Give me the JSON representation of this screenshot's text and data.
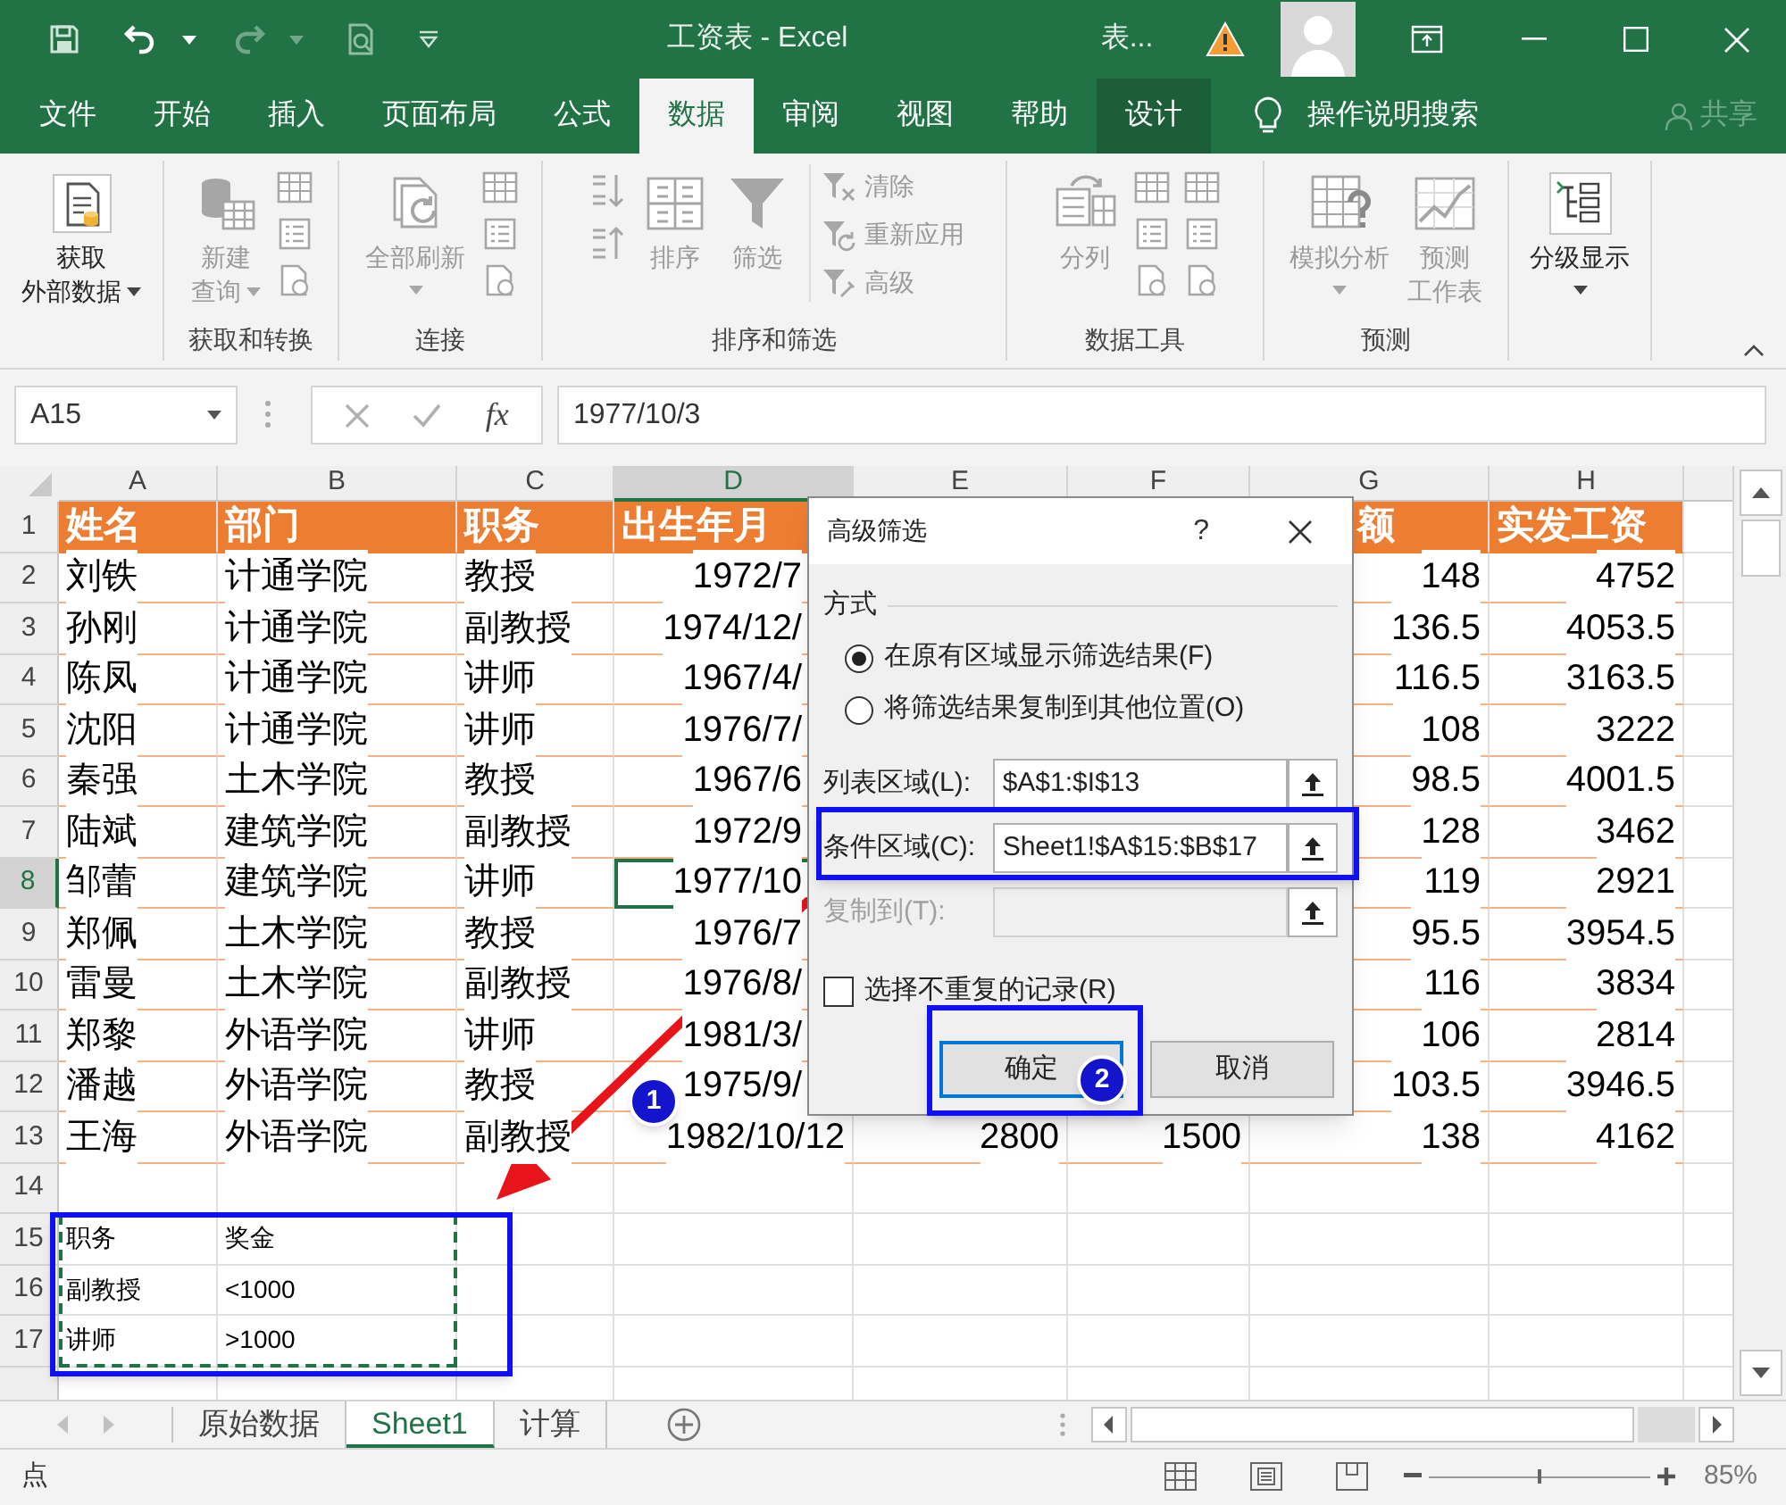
{
  "window": {
    "title": "工资表 - Excel",
    "account": "表...",
    "share": "共享"
  },
  "menu_tabs": [
    {
      "label": "文件",
      "kind": "normal",
      "selected": false
    },
    {
      "label": "开始",
      "kind": "normal",
      "selected": false
    },
    {
      "label": "插入",
      "kind": "normal",
      "selected": false
    },
    {
      "label": "页面布局",
      "kind": "normal",
      "selected": false
    },
    {
      "label": "公式",
      "kind": "normal",
      "selected": false
    },
    {
      "label": "数据",
      "kind": "normal",
      "selected": true
    },
    {
      "label": "审阅",
      "kind": "normal",
      "selected": false
    },
    {
      "label": "视图",
      "kind": "normal",
      "selected": false
    },
    {
      "label": "帮助",
      "kind": "normal",
      "selected": false
    },
    {
      "label": "设计",
      "kind": "contextual",
      "selected": false
    }
  ],
  "tell_me": "操作说明搜索",
  "ribbon_groups": [
    {
      "items": [
        {
          "kind": "large",
          "lines": [
            "获取",
            "外部数据"
          ],
          "dropdown": true,
          "disabled": false
        }
      ]
    },
    {
      "label": "获取和转换",
      "items": [
        {
          "kind": "large",
          "lines": [
            "新建",
            "查询"
          ],
          "dropdown": true,
          "disabled": true
        },
        {
          "kind": "tool_column",
          "disabled": true
        }
      ]
    },
    {
      "label": "连接",
      "items": [
        {
          "kind": "large",
          "lines": [
            "全部刷新"
          ],
          "dropdown": true,
          "disabled": true
        },
        {
          "kind": "tool_column",
          "disabled": true
        }
      ]
    },
    {
      "label": "排序和筛选",
      "items": [
        {
          "kind": "sort_column",
          "disabled": true
        },
        {
          "kind": "large",
          "lines": [
            "排序"
          ],
          "dropdown": false,
          "disabled": true
        },
        {
          "kind": "large",
          "lines": [
            "筛选"
          ],
          "dropdown": false,
          "disabled": true
        },
        {
          "kind": "text_stack",
          "entries": [
            {
              "label": "清除",
              "disabled": true
            },
            {
              "label": "重新应用",
              "disabled": true
            },
            {
              "label": "高级",
              "disabled": true
            }
          ]
        }
      ]
    },
    {
      "label": "数据工具",
      "items": [
        {
          "kind": "large",
          "lines": [
            "分列"
          ],
          "dropdown": false,
          "disabled": true
        },
        {
          "kind": "tool_column",
          "disabled": true
        },
        {
          "kind": "tool_column",
          "disabled": true
        }
      ]
    },
    {
      "label": "预测",
      "items": [
        {
          "kind": "large",
          "lines": [
            "模拟分析"
          ],
          "dropdown": true,
          "disabled": true
        },
        {
          "kind": "large",
          "lines": [
            "预测",
            "工作表"
          ],
          "dropdown": false,
          "disabled": true
        }
      ]
    },
    {
      "items": [
        {
          "kind": "large",
          "lines": [
            "分级显示"
          ],
          "dropdown": true,
          "disabled": false
        }
      ]
    }
  ],
  "formula_bar": {
    "name_box": "A15",
    "function_button": "fx",
    "value": "1977/10/3"
  },
  "sheet": {
    "copy_marquee": true,
    "columns": [
      {
        "letter": "A",
        "selected": false
      },
      {
        "letter": "B",
        "selected": false
      },
      {
        "letter": "C",
        "selected": false
      },
      {
        "letter": "D",
        "selected": true
      },
      {
        "letter": "E",
        "selected": false
      },
      {
        "letter": "F",
        "selected": false
      },
      {
        "letter": "G",
        "selected": false
      },
      {
        "letter": "H",
        "selected": false
      }
    ],
    "rows": [
      {
        "number": "1",
        "kind": "header",
        "selected": false,
        "cells": {
          "A": "姓名",
          "B": "部门",
          "C": "职务",
          "D": "出生年月",
          "G": "额",
          "H": "实发工资"
        }
      },
      {
        "number": "2",
        "kind": "record",
        "selected": false,
        "cells": {
          "A": "刘铁",
          "B": "计通学院",
          "C": "教授",
          "D": "1972/7",
          "G": "148",
          "H": "4752"
        }
      },
      {
        "number": "3",
        "kind": "record",
        "selected": false,
        "cells": {
          "A": "孙刚",
          "B": "计通学院",
          "C": "副教授",
          "D": "1974/12/",
          "G": "136.5",
          "H": "4053.5"
        }
      },
      {
        "number": "4",
        "kind": "record",
        "selected": false,
        "cells": {
          "A": "陈凤",
          "B": "计通学院",
          "C": "讲师",
          "D": "1967/4/",
          "G": "116.5",
          "H": "3163.5"
        }
      },
      {
        "number": "5",
        "kind": "record",
        "selected": false,
        "cells": {
          "A": "沈阳",
          "B": "计通学院",
          "C": "讲师",
          "D": "1976/7/",
          "G": "108",
          "H": "3222"
        }
      },
      {
        "number": "6",
        "kind": "record",
        "selected": false,
        "cells": {
          "A": "秦强",
          "B": "土木学院",
          "C": "教授",
          "D": "1967/6",
          "G": "98.5",
          "H": "4001.5"
        }
      },
      {
        "number": "7",
        "kind": "record",
        "selected": false,
        "cells": {
          "A": "陆斌",
          "B": "建筑学院",
          "C": "副教授",
          "D": "1972/9",
          "G": "128",
          "H": "3462"
        }
      },
      {
        "number": "8",
        "kind": "record",
        "selected": true,
        "cells": {
          "A": "邹蕾",
          "B": "建筑学院",
          "C": "讲师",
          "D": "1977/10",
          "G": "119",
          "H": "2921"
        }
      },
      {
        "number": "9",
        "kind": "record",
        "selected": false,
        "cells": {
          "A": "郑佩",
          "B": "土木学院",
          "C": "教授",
          "D": "1976/7",
          "G": "95.5",
          "H": "3954.5"
        }
      },
      {
        "number": "10",
        "kind": "record",
        "selected": false,
        "cells": {
          "A": "雷曼",
          "B": "土木学院",
          "C": "副教授",
          "D": "1976/8/",
          "G": "116",
          "H": "3834"
        }
      },
      {
        "number": "11",
        "kind": "record",
        "selected": false,
        "cells": {
          "A": "郑黎",
          "B": "外语学院",
          "C": "讲师",
          "D": "1981/3/",
          "G": "106",
          "H": "2814"
        }
      },
      {
        "number": "12",
        "kind": "record",
        "selected": false,
        "cells": {
          "A": "潘越",
          "B": "外语学院",
          "C": "教授",
          "D": "1975/9/",
          "G": "103.5",
          "H": "3946.5"
        }
      },
      {
        "number": "13",
        "kind": "record",
        "selected": false,
        "cells": {
          "A": "王海",
          "B": "外语学院",
          "C": "副教授",
          "D": "1982/10/12",
          "E": "2800",
          "F": "1500",
          "G": "138",
          "H": "4162"
        }
      },
      {
        "number": "14",
        "kind": "plain",
        "selected": false,
        "cells": {}
      },
      {
        "number": "15",
        "kind": "criteria",
        "selected": false,
        "cells": {
          "A": "职务",
          "B": "奖金"
        }
      },
      {
        "number": "16",
        "kind": "criteria",
        "selected": false,
        "cells": {
          "A": "副教授",
          "B": "<1000"
        }
      },
      {
        "number": "17",
        "kind": "criteria",
        "selected": false,
        "cells": {
          "A": "讲师",
          "B": ">1000"
        }
      }
    ]
  },
  "sheet_tabs": [
    {
      "label": "原始数据",
      "selected": false
    },
    {
      "label": "Sheet1",
      "selected": true
    },
    {
      "label": "计算",
      "selected": false
    }
  ],
  "status_bar": {
    "mode": "点",
    "zoom_slider": {
      "level": 0.5
    },
    "zoom": "85%"
  },
  "dialog": {
    "title": "高级筛选",
    "help": "?",
    "section": "方式",
    "options": [
      {
        "label": "在原有区域显示筛选结果(F)",
        "selected": true
      },
      {
        "label": "将筛选结果复制到其他位置(O)",
        "selected": false
      }
    ],
    "fields": [
      {
        "label": "列表区域(L):",
        "value": "$A$1:$I$13",
        "disabled": false
      },
      {
        "label": "条件区域(C):",
        "value": "Sheet1!$A$15:$B$17",
        "disabled": false
      },
      {
        "label": "复制到(T):",
        "disabled": true
      }
    ],
    "unique_only": {
      "label": "选择不重复的记录(R)",
      "checked": false
    },
    "buttons": [
      {
        "label": "确定",
        "default": true
      },
      {
        "label": "取消",
        "default": false
      }
    ]
  },
  "callouts": [
    "1",
    "2"
  ]
}
